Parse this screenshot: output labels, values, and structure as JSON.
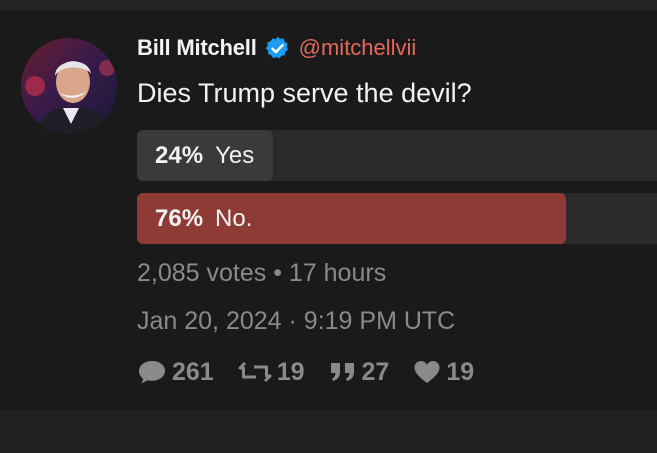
{
  "tweet": {
    "author_name": "Bill Mitchell",
    "handle": "@mitchellvii",
    "text": "Dies Trump serve the devil?"
  },
  "poll": {
    "options": [
      {
        "percent_label": "24%",
        "label": "Yes",
        "fraction": 0.24,
        "color": "#3a3a3a"
      },
      {
        "percent_label": "76%",
        "label": "No.",
        "fraction": 0.76,
        "color": "#8e3b35"
      }
    ],
    "summary": "2,085 votes • 17 hours"
  },
  "timestamp": "Jan 20, 2024 · 9:19 PM UTC",
  "stats": {
    "replies": "261",
    "retweets": "19",
    "quotes": "27",
    "likes": "19"
  },
  "colors": {
    "handle": "#e6685b",
    "verified": "#1d9bf0",
    "background": "#1a1a1a"
  }
}
